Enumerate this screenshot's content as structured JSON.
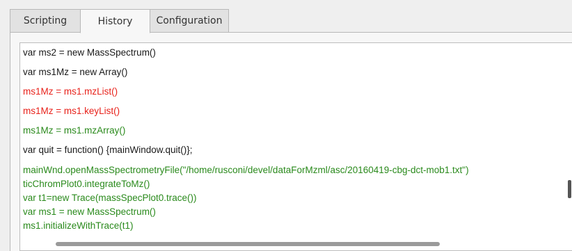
{
  "tabs": [
    {
      "label": "Scripting",
      "active": false
    },
    {
      "label": "History",
      "active": true
    },
    {
      "label": "Configuration",
      "active": false
    }
  ],
  "history": {
    "lines": [
      {
        "text": "var ms2 = new MassSpectrum()",
        "color": "#1a1a1a"
      },
      {
        "text": "var ms1Mz = new Array()",
        "color": "#1a1a1a"
      },
      {
        "text": "ms1Mz = ms1.mzList()",
        "color": "#e8221b"
      },
      {
        "text": "ms1Mz = ms1.keyList()",
        "color": "#e8221b"
      },
      {
        "text": "ms1Mz = ms1.mzArray()",
        "color": "#2a8a1c"
      },
      {
        "text": "var quit = function() {mainWindow.quit()};",
        "color": "#1a1a1a"
      },
      {
        "text": "mainWnd.openMassSpectrometryFile(\"/home/rusconi/devel/dataForMzml/asc/20160419-cbg-dct-mob1.txt\")",
        "color": "#2a8a1c"
      },
      {
        "text": "ticChromPlot0.integrateToMz()",
        "color": "#2a8a1c"
      },
      {
        "text": "var t1=new Trace(massSpecPlot0.trace())",
        "color": "#2a8a1c"
      },
      {
        "text": "var ms1 = new MassSpectrum()",
        "color": "#2a8a1c"
      },
      {
        "text": "ms1.initializeWithTrace(t1)",
        "color": "#2a8a1c"
      }
    ]
  }
}
